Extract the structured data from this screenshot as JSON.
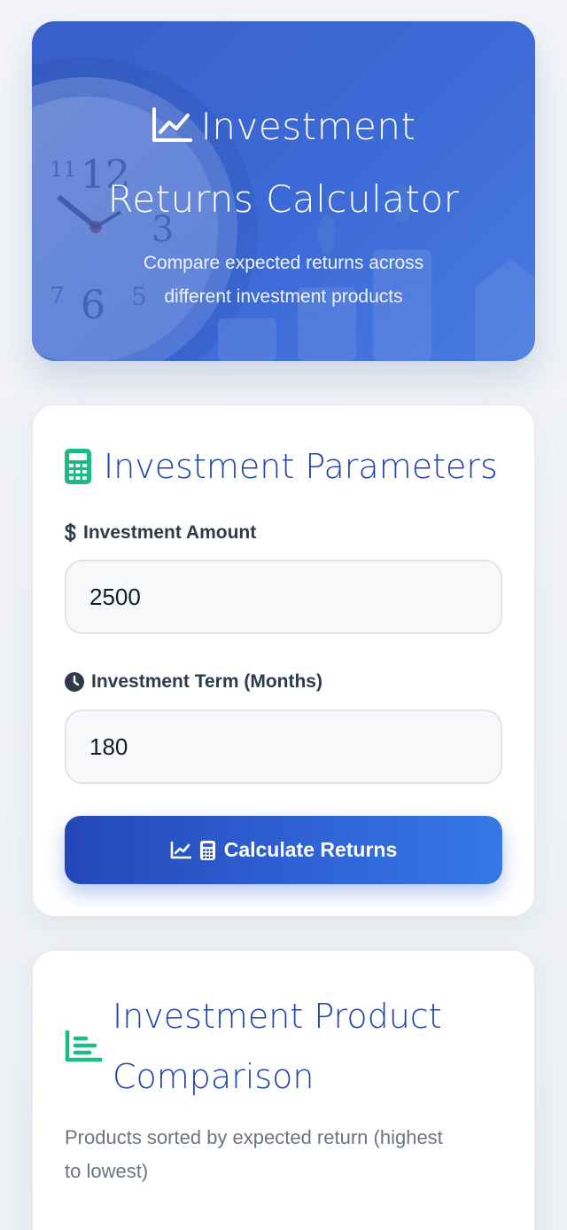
{
  "hero": {
    "title": "Investment Returns Calculator",
    "subtitle": "Compare expected returns across different investment products",
    "icon": "chart-line-icon",
    "background": "clock-and-coins-photo",
    "accent": "#3f6fd8"
  },
  "parameters": {
    "title": "Investment Parameters",
    "icon": "calculator-icon",
    "amount": {
      "label": "Investment Amount",
      "icon": "dollar-icon",
      "value": "2500"
    },
    "term": {
      "label": "Investment Term (Months)",
      "icon": "clock-icon",
      "value": "180"
    },
    "calculate_button": {
      "label": "Calculate Returns",
      "icons": [
        "chart-line-icon",
        "calculator-icon"
      ],
      "color": "#2f62d4"
    }
  },
  "comparison": {
    "title": "Investment Product Comparison",
    "icon": "bar-chart-icon",
    "description": "Products sorted by expected return (highest to lowest)",
    "accent": "#16b98a"
  },
  "colors": {
    "heading": "#1f43ad",
    "green_icon": "#1fb985",
    "label_text": "#2f3a4a",
    "muted_text": "#6b7482"
  }
}
